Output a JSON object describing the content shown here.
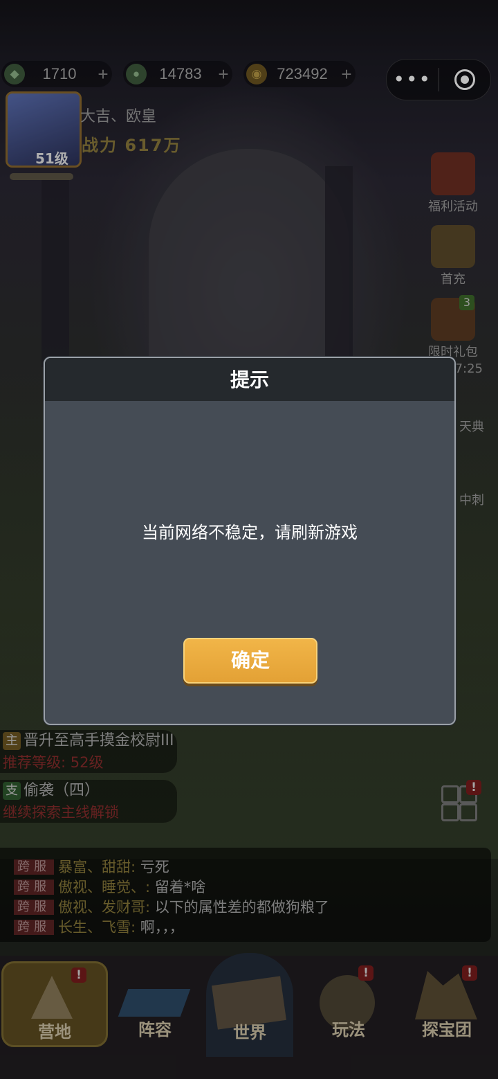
{
  "resources": [
    {
      "icon": "green-gem-icon",
      "value": "1710"
    },
    {
      "icon": "money-bag-icon",
      "value": "14783"
    },
    {
      "icon": "gold-coin-icon",
      "value": "723492"
    }
  ],
  "miniprogram": {
    "more": "•••"
  },
  "player": {
    "name": "大吉、欧皇",
    "power": "战力 617万",
    "level": "51级"
  },
  "side_activities": [
    "福利活动",
    "首充",
    "限时礼包",
    "天典",
    "中刺"
  ],
  "side_badge": "3",
  "side_timer": "7:25",
  "quests": [
    {
      "tag": "主",
      "title": "晋升至高手摸金校尉III",
      "sub": "推荐等级: 52级"
    },
    {
      "tag": "支",
      "title": "偷袭（四）",
      "sub": "继续探索主线解锁"
    }
  ],
  "chat": [
    {
      "server": "跨服",
      "who": "暴富、甜甜:",
      "msg": " 亏死"
    },
    {
      "server": "跨服",
      "who": "傲视、睡觉、:",
      "msg": " 留着*啥"
    },
    {
      "server": "跨服",
      "who": "傲视、发财哥:",
      "msg": " 以下的属性差的都做狗粮了"
    },
    {
      "server": "跨服",
      "who": "长生、飞雪:",
      "msg": " 啊，，，"
    }
  ],
  "nav": [
    {
      "label": "营地",
      "alert": "!"
    },
    {
      "label": "阵容",
      "alert": ""
    },
    {
      "label": "世界",
      "alert": ""
    },
    {
      "label": "玩法",
      "alert": "!"
    },
    {
      "label": "探宝团",
      "alert": "!"
    }
  ],
  "dialog": {
    "title": "提示",
    "message": "当前网络不稳定，请刷新游戏",
    "confirm": "确定"
  }
}
